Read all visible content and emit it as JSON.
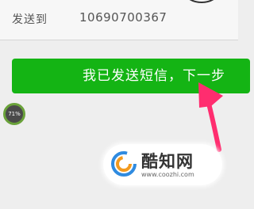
{
  "header": {
    "send_to_label": "发送到",
    "send_to_number": "10690700367"
  },
  "main": {
    "confirm_button_label": "我已发送短信，下一步",
    "button_color": "#14b414"
  },
  "overlay": {
    "progress_label": "71%",
    "progress_value": 0.71,
    "arrow_color": "#ff2d6f"
  },
  "watermark": {
    "name": "酷知网",
    "url": "www.coozhi.com",
    "logo_icon": "coozhi-logo-icon"
  }
}
